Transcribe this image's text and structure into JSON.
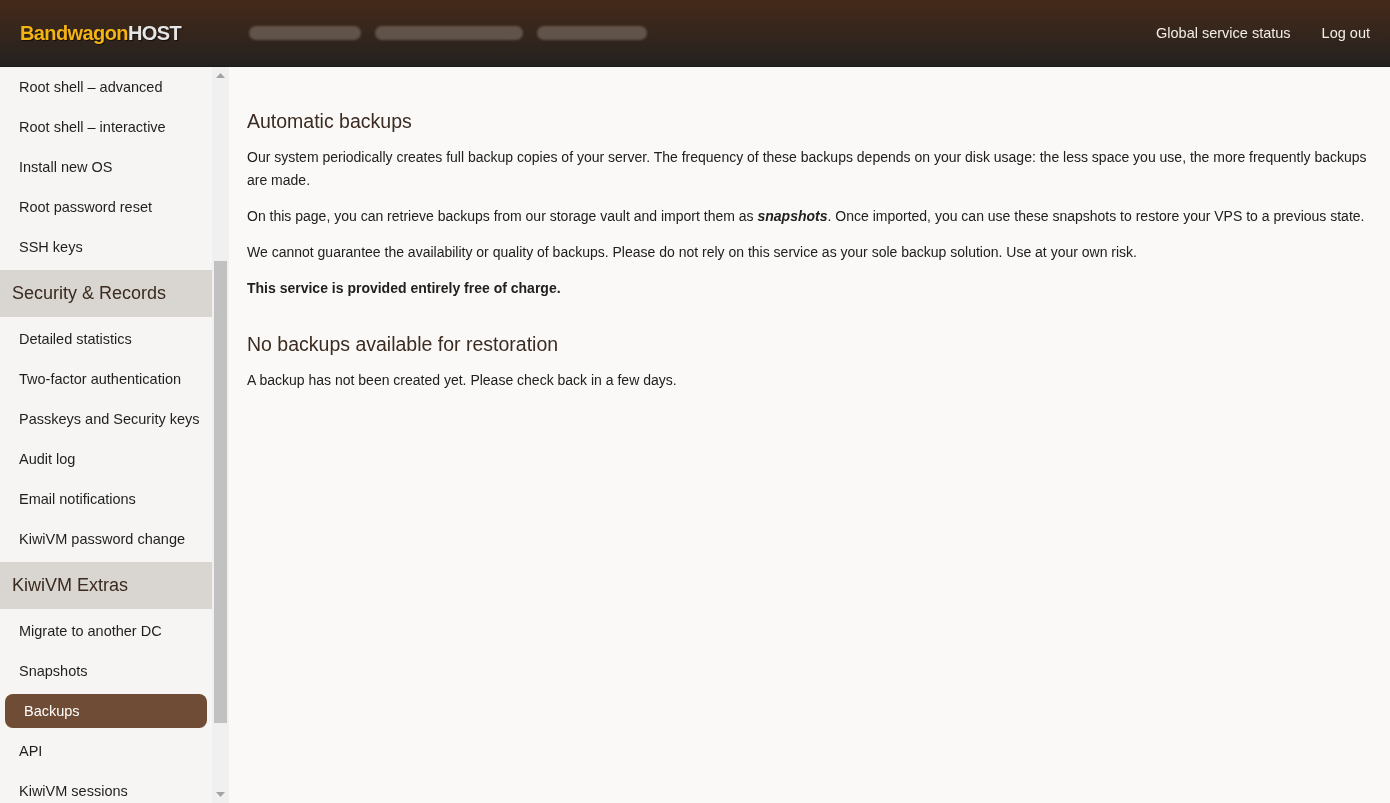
{
  "header": {
    "logo": {
      "brand": "Bandwagon",
      "suffix": "HOST"
    },
    "links": [
      "Global service status",
      "Log out"
    ]
  },
  "sidebar": {
    "sections": [
      {
        "items": [
          {
            "label": "Root shell – advanced",
            "selected": false
          },
          {
            "label": "Root shell – interactive",
            "selected": false
          },
          {
            "label": "Install new OS",
            "selected": false
          },
          {
            "label": "Root password reset",
            "selected": false
          },
          {
            "label": "SSH keys",
            "selected": false
          }
        ]
      },
      {
        "title": "Security & Records",
        "items": [
          {
            "label": "Detailed statistics",
            "selected": false
          },
          {
            "label": "Two-factor authentication",
            "selected": false
          },
          {
            "label": "Passkeys and Security keys",
            "selected": false
          },
          {
            "label": "Audit log",
            "selected": false
          },
          {
            "label": "Email notifications",
            "selected": false
          },
          {
            "label": "KiwiVM password change",
            "selected": false
          }
        ]
      },
      {
        "title": "KiwiVM Extras",
        "items": [
          {
            "label": "Migrate to another DC",
            "selected": false
          },
          {
            "label": "Snapshots",
            "selected": false
          },
          {
            "label": "Backups",
            "selected": true
          },
          {
            "label": "API",
            "selected": false
          },
          {
            "label": "KiwiVM sessions",
            "selected": false
          }
        ]
      }
    ]
  },
  "content": {
    "sections": [
      {
        "title": "Automatic backups",
        "paragraphs": [
          {
            "text": "Our system periodically creates full backup copies of your server. The frequency of these backups depends on your disk usage: the less space you use, the more frequently backups are made.",
            "bold": false
          },
          {
            "text": "On this page, you can retrieve backups from our storage vault and import them as **snapshots**. Once imported, you can use these snapshots to restore your VPS to a previous state.",
            "bold": false
          },
          {
            "text": "We cannot guarantee the availability or quality of backups. Please do not rely on this service as your sole backup solution. Use at your own risk.",
            "bold": false
          },
          {
            "text": "This service is provided entirely free of charge.",
            "bold": true
          }
        ]
      },
      {
        "title": "No backups available for restoration",
        "paragraphs": [
          {
            "text": "A backup has not been created yet. Please check back in a few days.",
            "bold": false
          }
        ]
      }
    ]
  }
}
